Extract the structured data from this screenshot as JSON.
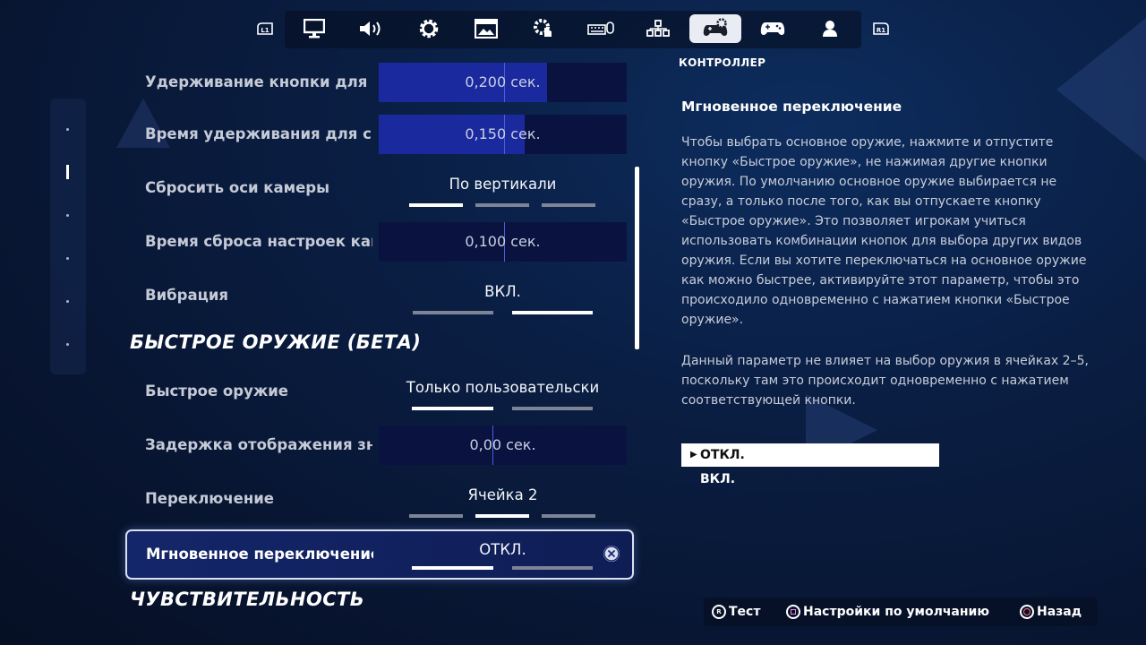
{
  "tabs": [
    {
      "icon": "l1-bumper-icon"
    },
    {
      "icon": "monitor-icon"
    },
    {
      "icon": "speaker-icon"
    },
    {
      "icon": "gear-icon"
    },
    {
      "icon": "game-ui-icon"
    },
    {
      "icon": "touch-gear-icon"
    },
    {
      "icon": "keyboard-mouse-icon"
    },
    {
      "icon": "controller-layout-icon"
    },
    {
      "icon": "controller-gear-icon",
      "active": true
    },
    {
      "icon": "gamepad-icon"
    },
    {
      "icon": "account-icon"
    },
    {
      "icon": "r1-bumper-icon"
    }
  ],
  "bumpers": {
    "left": "L1",
    "right": "R1"
  },
  "section_title": "КОНТРОЛЛЕР",
  "settings": {
    "hold_button": {
      "label": "Удерживание кнопки для р",
      "value": "0,200 сек.",
      "fill": 0.68
    },
    "hold_time": {
      "label": "Время удерживания для ск",
      "value": "0,150 сек.",
      "fill": 0.59
    },
    "reset_camera": {
      "label": "Сбросить оси камеры",
      "value": "По вертикали",
      "options": 3,
      "selected": 0
    },
    "reset_time": {
      "label": "Время сброса настроек кам",
      "value": "0,100 сек.",
      "fill": 0.0
    },
    "vibration": {
      "label": "Вибрация",
      "value": "ВКЛ.",
      "options": 2,
      "selected": 1
    },
    "quick_weapon_heading": "БЫСТРОЕ ОРУЖИЕ (БЕТА)",
    "quick_weapon": {
      "label": "Быстрое оружие",
      "value": "Только пользовательски",
      "options": 2,
      "selected": 0
    },
    "display_delay": {
      "label": "Задержка отображения зна",
      "value": "0,00 сек.",
      "fill": 0.0
    },
    "switching": {
      "label": "Переключение",
      "value": "Ячейка 2",
      "options": 3,
      "selected": 1
    },
    "instant_switch": {
      "label": "Мгновенное переключение",
      "value": "ОТКЛ.",
      "options": 2,
      "selected": 0
    },
    "sensitivity_heading": "ЧУВСТВИТЕЛЬНОСТЬ"
  },
  "description": {
    "title": "Мгновенное переключение",
    "p1": "Чтобы выбрать основное оружие, нажмите и отпустите кнопку «Быстрое оружие», не нажимая другие кнопки оружия. По умолчанию основное оружие выбирается не сразу, а только после того, как вы отпускаете кнопку «Быстрое оружие». Это позволяет игрокам учиться использовать комбинации кнопок для выбора других видов оружия. Если вы хотите переключаться на основное оружие как можно быстрее, активируйте этот параметр, чтобы это происходило одновременно с нажатием кнопки «Быстрое оружие».",
    "p2": "Данный параметр не влияет на выбор оружия в ячейках 2–5, поскольку там это происходит одновременно с нажатием соответствующей кнопки."
  },
  "options": {
    "off": "ОТКЛ.",
    "on": "ВКЛ."
  },
  "footer": {
    "test": "Тест",
    "defaults": "Настройки по умолчанию",
    "back": "Назад",
    "test_button": "R"
  },
  "colors": {
    "accent": "#1a2a9e",
    "background": "#081633",
    "focus_border": "#dbe0ee"
  }
}
